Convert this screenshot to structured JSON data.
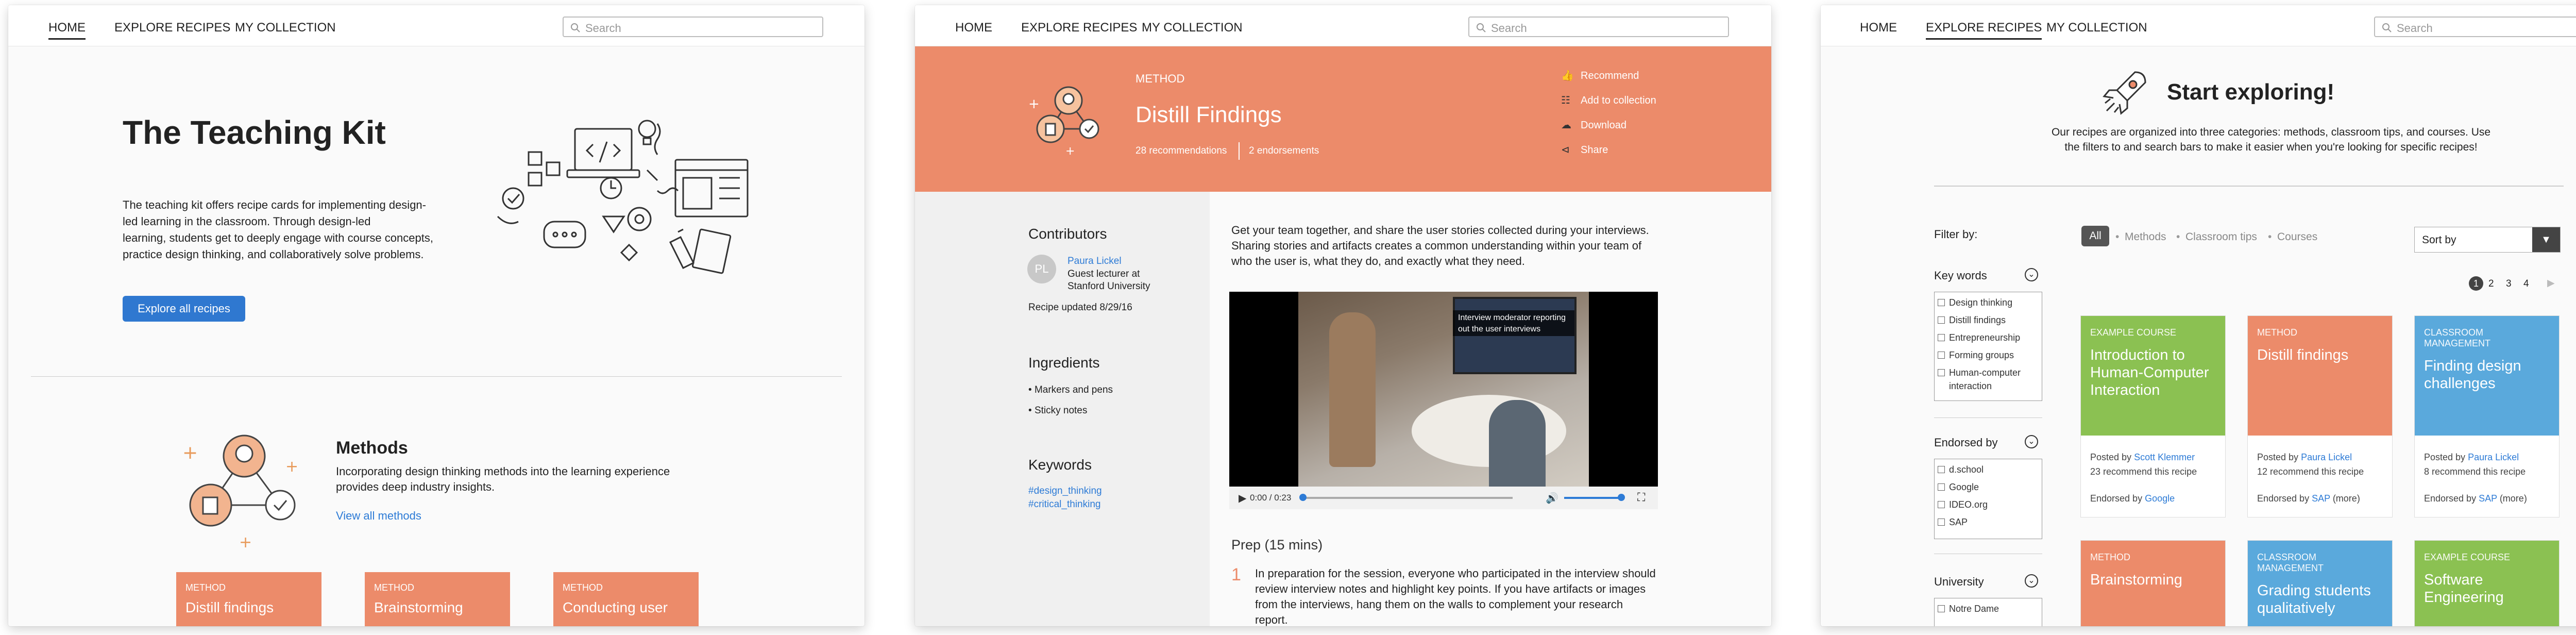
{
  "nav": {
    "home": "HOME",
    "explore": "EXPLORE RECIPES",
    "collection": "MY COLLECTION",
    "search_placeholder": "Search"
  },
  "p1": {
    "title": "The Teaching Kit",
    "intro": [
      "The teaching kit offers recipe cards for implementing design-",
      "led learning in the classroom. Through design-led",
      "learning, students get to deeply engage with course concepts,",
      "practice design thinking, and collaboratively solve problems."
    ],
    "explore_button": "Explore all recipes",
    "methods_title": "Methods",
    "methods_desc": [
      "Incorporating design thinking methods into the learning experience",
      "provides deep industry insights."
    ],
    "view_all": "View all methods",
    "cards": [
      {
        "tag": "METHOD",
        "title": "Distill findings"
      },
      {
        "tag": "METHOD",
        "title": "Brainstorming"
      },
      {
        "tag": "METHOD",
        "title": "Conducting user"
      }
    ]
  },
  "p2": {
    "tag": "METHOD",
    "title": "Distill Findings",
    "recommendations": "28 recommendations",
    "endorsements": "2 endorsements",
    "actions": [
      "Recommend",
      "Add to collection",
      "Download",
      "Share"
    ],
    "contributors_h": "Contributors",
    "contributor_initials": "PL",
    "contributor_name": "Paura Lickel",
    "contributor_role": [
      "Guest lecturer at",
      "Stanford University"
    ],
    "updated": "Recipe updated 8/29/16",
    "ingredients_h": "Ingredients",
    "ingredients": [
      "Markers and pens",
      "Sticky notes"
    ],
    "keywords_h": "Keywords",
    "keywords": [
      "#design_thinking",
      "#critical_thinking"
    ],
    "body": [
      "Get your team together, and share the user stories collected during your interviews.",
      "Sharing stories and artifacts creates a common understanding within your team of",
      "who the user is, what they do, and exactly what they need."
    ],
    "video_caption": [
      "Interview moderator reporting",
      "out the user interviews"
    ],
    "video_time": "0:00 / 0:23",
    "prep_h": "Prep (15 mins)",
    "step_num": "1",
    "step_text": [
      "In preparation for the session, everyone who participated in the interview should",
      "review interview notes and highlight key points. If you have artifacts or images",
      "from the interviews, hang them on the walls to complement your research",
      "report."
    ]
  },
  "p3": {
    "hero_title": "Start exploring!",
    "hero_text": [
      "Our recipes are organized into three categories: methods, classroom tips, and courses. Use",
      "the filters to and search bars to make it easier when you're looking for specific recipes!"
    ],
    "filter_by": "Filter by:",
    "keywords_h": "Key words",
    "keywords": [
      "Design thinking",
      "Distill findings",
      "Entrepreneurship",
      "Forming groups",
      "Human-computer",
      "interaction"
    ],
    "endorsed_h": "Endorsed by",
    "endorsed": [
      "d.school",
      "Google",
      "IDEO.org",
      "SAP"
    ],
    "university_h": "University",
    "university": [
      "Notre Dame"
    ],
    "tabs": [
      "All",
      "Methods",
      "Classroom tips",
      "Courses"
    ],
    "sort": "Sort by",
    "pages": [
      "1",
      "2",
      "3",
      "4"
    ],
    "cards": [
      {
        "tag": "EXAMPLE COURSE",
        "title": [
          "Introduction to",
          "Human-Computer",
          "Interaction"
        ],
        "posted": "Posted by",
        "author": "Scott Klemmer",
        "rec": "23 recommend this recipe",
        "endorsed": "Endorsed by",
        "endorser": "Google",
        "more": "",
        "color": "#8bc152"
      },
      {
        "tag": "METHOD",
        "title": [
          "Distill findings"
        ],
        "posted": "Posted by",
        "author": "Paura Lickel",
        "rec": "12 recommend this recipe",
        "endorsed": "Endorsed by",
        "endorser": "SAP",
        "more": "(more)",
        "color": "#ec8b6a"
      },
      {
        "tag": "CLASSROOM MANAGEMENT",
        "title": [
          "Finding design",
          "challenges"
        ],
        "posted": "Posted by",
        "author": "Paura Lickel",
        "rec": "8 recommend this recipe",
        "endorsed": "Endorsed by",
        "endorser": "SAP",
        "more": "(more)",
        "color": "#5aa9dc"
      },
      {
        "tag": "METHOD",
        "title": [
          "Brainstorming"
        ],
        "color": "#ec8b6a"
      },
      {
        "tag": "CLASSROOM MANAGEMENT",
        "title": [
          "Grading students",
          "qualitatively"
        ],
        "color": "#5aa9dc"
      },
      {
        "tag": "EXAMPLE COURSE",
        "title": [
          "Software",
          "Engineering"
        ],
        "color": "#8bc152"
      }
    ]
  },
  "colors": {
    "accent": "#2f78d0",
    "method": "#ec8b6a",
    "course": "#8bc152",
    "classroom": "#5aa9dc"
  }
}
